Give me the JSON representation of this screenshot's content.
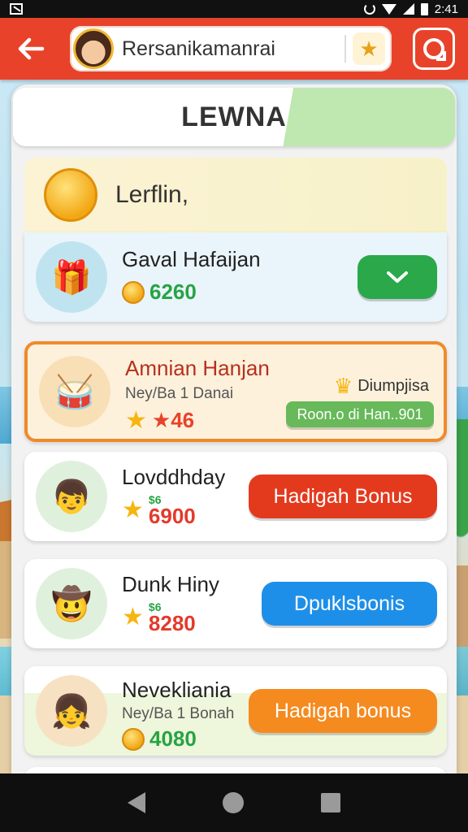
{
  "status_bar": {
    "time": "2:41"
  },
  "header": {
    "search_text": "Rersanikamanrai",
    "back_icon": "arrow-left-icon",
    "badge_icon": "award-icon",
    "settings_icon": "refresh-icon"
  },
  "panel": {
    "title": "LEWNA"
  },
  "section": {
    "title": "Lerflin,"
  },
  "tasks": [
    {
      "name": "Gaval Hafaijan",
      "sub": "",
      "reward": "6260",
      "reward_color": "#27a344",
      "action": "",
      "action_color": "#27a344"
    },
    {
      "name": "Amnian Hanjan",
      "sub": "Ney/Ba 1 Danai",
      "reward": "★46",
      "reward_color": "#e8432a",
      "badge": "Diumpjisa",
      "badge_sub": "Roon.o di Han..901",
      "action": "",
      "action_color": ""
    },
    {
      "name": "Lovddhday",
      "sub": "",
      "reward_top": "$6",
      "reward": "6900",
      "reward_color": "#e33a2a",
      "action": "Hadigah Bonus",
      "action_color": "#e33a1e"
    },
    {
      "name": "Dunk Hiny",
      "sub": "",
      "reward_top": "$6",
      "reward": "8280",
      "reward_color": "#e33a2a",
      "action": "Dpuklsbonis",
      "action_color": "#1e8fe8"
    },
    {
      "name": "Nevekliania",
      "sub": "Ney/Ba 1 Bonah",
      "reward": "4080",
      "reward_color": "#27a344",
      "action": "Hadigah bonus",
      "action_color": "#f58a1f"
    }
  ],
  "colors": {
    "header": "#e8432a",
    "highlight_border": "#f08a2a"
  }
}
